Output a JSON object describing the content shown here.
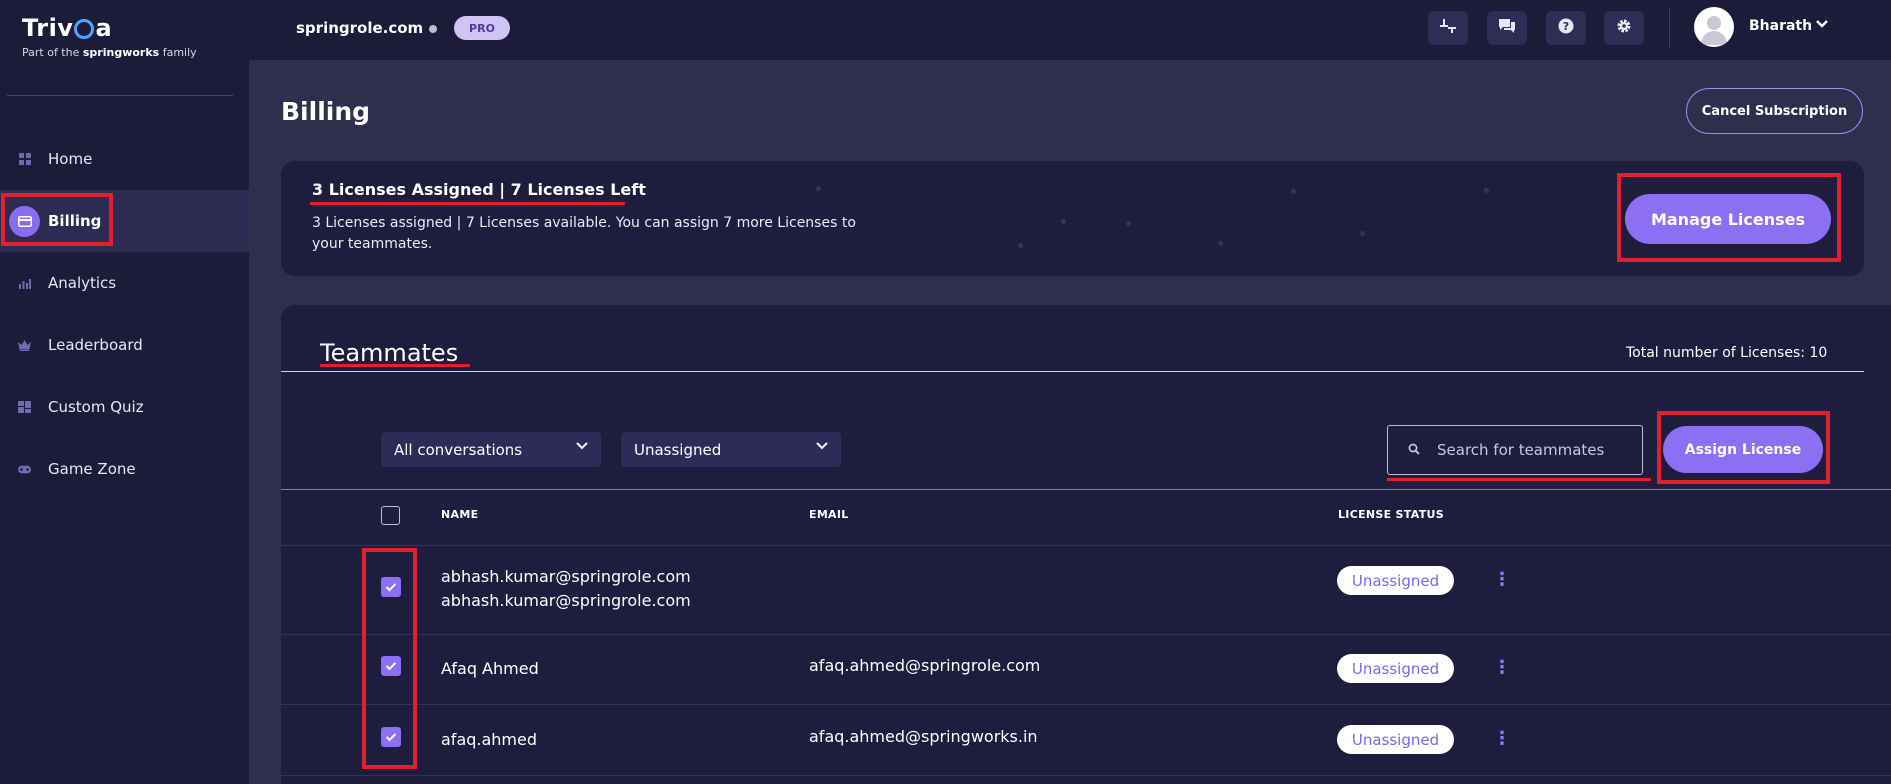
{
  "brand": {
    "name_prefix": "Triv",
    "name_suffix": "a",
    "tagline_prefix": "Part of the",
    "tagline_brand": "springworks",
    "tagline_suffix": "family"
  },
  "sidebar": {
    "items": [
      {
        "label": "Home",
        "icon": "grid-icon",
        "active": false
      },
      {
        "label": "Billing",
        "icon": "card-icon",
        "active": true
      },
      {
        "label": "Analytics",
        "icon": "chart-icon",
        "active": false
      },
      {
        "label": "Leaderboard",
        "icon": "crown-icon",
        "active": false
      },
      {
        "label": "Custom Quiz",
        "icon": "quiz-icon",
        "active": false
      },
      {
        "label": "Game Zone",
        "icon": "gamepad-icon",
        "active": false
      }
    ]
  },
  "header": {
    "org": "springrole.com",
    "plan_badge": "PRO",
    "user_name": "Bharath"
  },
  "main": {
    "title": "Billing",
    "cancel_label": "Cancel Subscription",
    "summary": {
      "title": "3 Licenses Assigned | 7 Licenses Left",
      "description": "3 Licenses assigned | 7 Licenses available. You can assign 7 more Licenses to your teammates.",
      "manage_label": "Manage Licenses"
    },
    "teammates": {
      "title": "Teammates",
      "total_licenses": "Total number of Licenses: 10",
      "filter_conversations": "All conversations",
      "filter_status": "Unassigned",
      "search_placeholder": "Search for teammates",
      "assign_label": "Assign License",
      "columns": {
        "name": "NAME",
        "email": "EMAIL",
        "status": "LICENSE STATUS"
      },
      "rows": [
        {
          "name": "abhash.kumar@springrole.com",
          "name2": "abhash.kumar@springrole.com",
          "email": "",
          "status": "Unassigned",
          "checked": true
        },
        {
          "name": "Afaq Ahmed",
          "email": "afaq.ahmed@springrole.com",
          "status": "Unassigned",
          "checked": true
        },
        {
          "name": "afaq.ahmed",
          "email": "afaq.ahmed@springworks.in",
          "status": "Unassigned",
          "checked": true
        }
      ]
    }
  },
  "colors": {
    "accent": "#8c6ff2",
    "sidebar_bg": "#1c1b3a",
    "page_bg": "#2f2f4d",
    "annotation_red": "#e0202e"
  }
}
